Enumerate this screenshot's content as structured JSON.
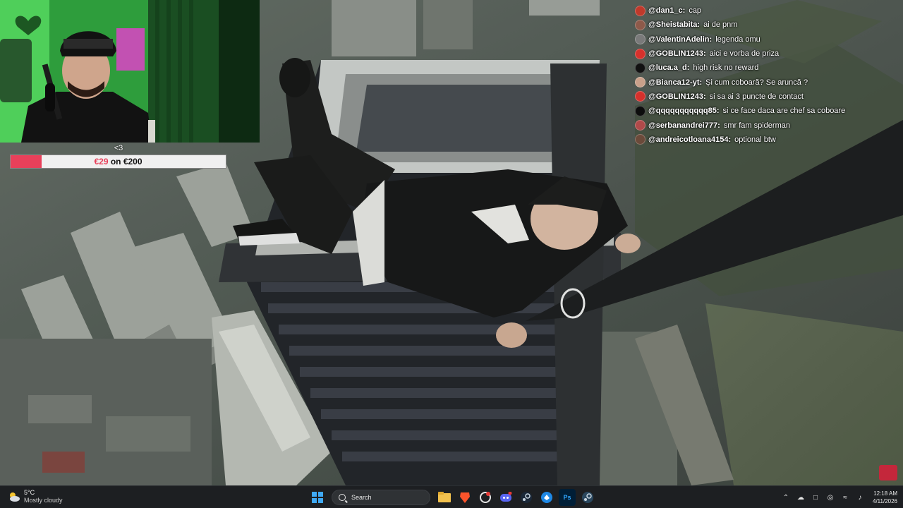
{
  "goal": {
    "heart": "<3",
    "current": "€29",
    "separator": " on ",
    "target": "€200",
    "progress_fraction": 0.145,
    "fill_color": "#e8405a"
  },
  "chat": [
    {
      "user": "@dan1_c:",
      "text": "cap",
      "avatar_color": "#c0392b"
    },
    {
      "user": "@Sheistabita:",
      "text": "ai de pnm",
      "avatar_color": "#8e5a4a"
    },
    {
      "user": "@ValentinAdelin:",
      "text": "legenda omu",
      "avatar_color": "#7a7a7a"
    },
    {
      "user": "@GOBLIN1243:",
      "text": "aici e vorba de priza",
      "avatar_color": "#d6312c"
    },
    {
      "user": "@luca.a_d:",
      "text": "high risk no reward",
      "avatar_color": "#111111"
    },
    {
      "user": "@Bianca12-yt:",
      "text": "Și cum coboară? Se aruncă ?",
      "avatar_color": "#c9a08a"
    },
    {
      "user": "@GOBLIN1243:",
      "text": "si sa ai 3 puncte de contact",
      "avatar_color": "#d6312c"
    },
    {
      "user": "@qqqqqqqqqqq85:",
      "text": "si ce face daca are chef sa coboare",
      "avatar_color": "#0d0d0d"
    },
    {
      "user": "@serbanandrei777:",
      "text": "smr fam spiderman",
      "avatar_color": "#b04a4a"
    },
    {
      "user": "@andreicotloana4154:",
      "text": "optional btw",
      "avatar_color": "#6b4a3a"
    }
  ],
  "taskbar": {
    "weather": {
      "temp": "5°C",
      "desc": "Mostly cloudy",
      "icon": "cloud-sun-icon"
    },
    "search_label": "Search",
    "pinned": [
      {
        "name": "windows-start-icon",
        "label": ""
      },
      {
        "name": "file-explorer-icon",
        "label": ""
      },
      {
        "name": "brave-browser-icon",
        "label": ""
      },
      {
        "name": "chatgpt-icon",
        "label": ""
      },
      {
        "name": "discord-icon",
        "label": ""
      },
      {
        "name": "steam-icon",
        "label": ""
      },
      {
        "name": "app-icon",
        "label": ""
      },
      {
        "name": "photoshop-icon",
        "label": "Ps"
      },
      {
        "name": "steam-icon-2",
        "label": ""
      }
    ],
    "time": "12:18 AM",
    "date": "4/11/2026"
  }
}
